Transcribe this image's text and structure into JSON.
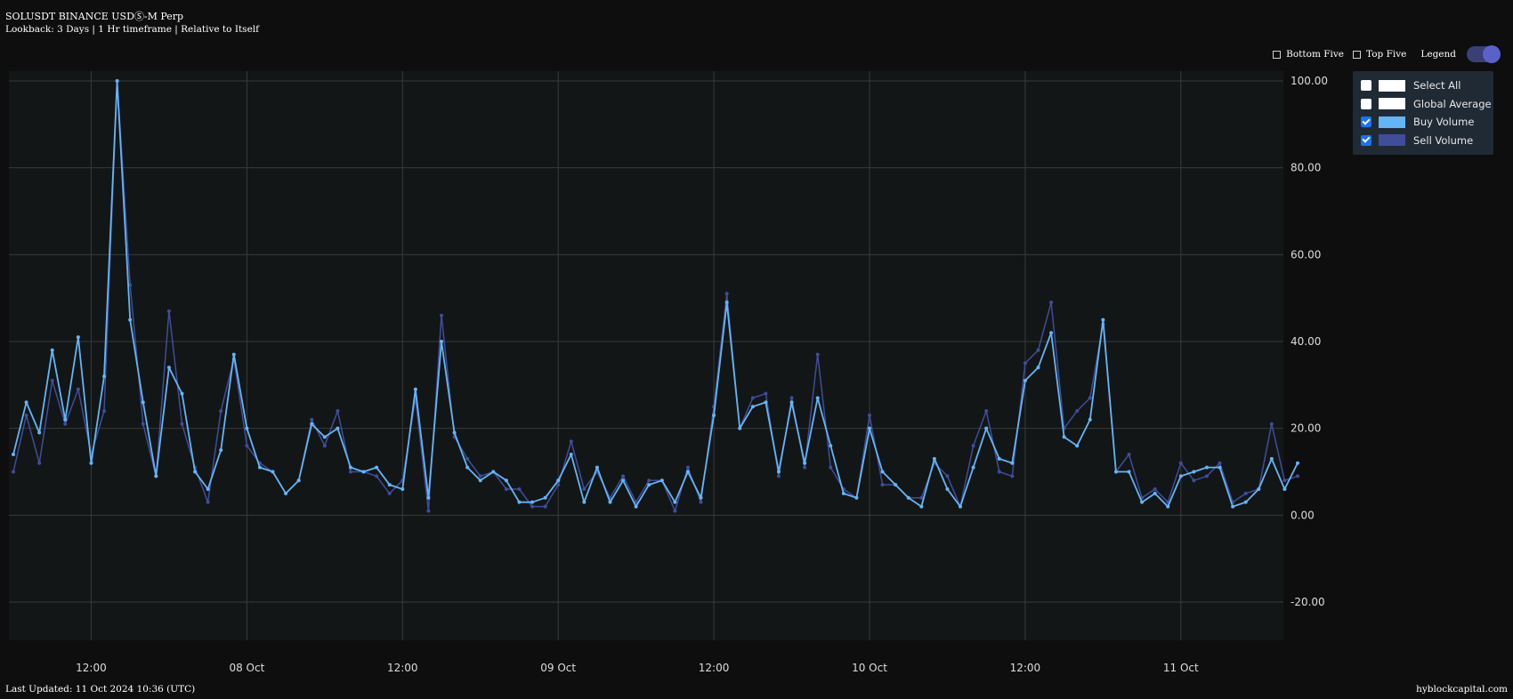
{
  "header": {
    "title": "SOLUSDT BINANCE USDⓈ-M Perp",
    "subtitle": "Lookback: 3 Days | 1 Hr timeframe | Relative to Itself"
  },
  "controls": {
    "bottom_five": "Bottom Five",
    "top_five": "Top Five",
    "legend": "Legend",
    "legend_toggle_on": true
  },
  "legend_panel": {
    "items": [
      {
        "label": "Select All",
        "checked": false,
        "color": "#ffffff"
      },
      {
        "label": "Global Average",
        "checked": false,
        "color": "#ffffff"
      },
      {
        "label": "Buy Volume",
        "checked": true,
        "color": "#64b5f6"
      },
      {
        "label": "Sell Volume",
        "checked": true,
        "color": "#3f4d9a"
      }
    ]
  },
  "footer": {
    "last_updated": "Last Updated: 11 Oct 2024 10:36 (UTC)",
    "brand": "hyblockcapital.com"
  },
  "colors": {
    "background": "#0e0e0f",
    "plot_background": "#131617",
    "grid": "#3a3a3a",
    "buy": "#64b5f6",
    "sell": "#3f4d9a"
  },
  "chart_data": {
    "type": "line",
    "title": "",
    "xlabel": "",
    "ylabel": "",
    "ylim": [
      -20,
      100
    ],
    "yticks": [
      -20,
      0,
      20,
      40,
      60,
      80,
      100
    ],
    "ytick_labels": [
      "-20.00",
      "0.00",
      "20.00",
      "40.00",
      "60.00",
      "80.00",
      "100.00"
    ],
    "x_start": "07 Oct 2024 06:00",
    "x_end": "11 Oct 2024 11:00",
    "x_interval": "1 hour",
    "xticks": [
      "12:00",
      "08 Oct",
      "12:00",
      "09 Oct",
      "12:00",
      "10 Oct",
      "12:00",
      "11 Oct"
    ],
    "grid": true,
    "legend_position": "top-right",
    "series": [
      {
        "name": "Buy Volume",
        "values": [
          14,
          26,
          19,
          38,
          22,
          41,
          12,
          32,
          100,
          45,
          26,
          9,
          34,
          28,
          10,
          6,
          15,
          37,
          20,
          11,
          10,
          5,
          8,
          21,
          18,
          20,
          11,
          10,
          11,
          7,
          6,
          29,
          4,
          40,
          19,
          11,
          8,
          10,
          8,
          3,
          3,
          4,
          8,
          14,
          3,
          11,
          3,
          8,
          2,
          7,
          8,
          3,
          10,
          4,
          23,
          49,
          20,
          25,
          26,
          10,
          26,
          12,
          27,
          16,
          5,
          4,
          20,
          10,
          7,
          4,
          2,
          13,
          6,
          2,
          11,
          20,
          13,
          12,
          31,
          34,
          42,
          18,
          16,
          22,
          45,
          10,
          10,
          3,
          5,
          2,
          9,
          10,
          11,
          11,
          2,
          3,
          6,
          13,
          6,
          12
        ]
      },
      {
        "name": "Sell Volume",
        "values": [
          10,
          23,
          12,
          31,
          21,
          29,
          14,
          24,
          100,
          53,
          21,
          9,
          47,
          21,
          11,
          3,
          24,
          36,
          16,
          12,
          10,
          5,
          8,
          22,
          16,
          24,
          10,
          10,
          9,
          5,
          8,
          27,
          1,
          46,
          18,
          13,
          9,
          10,
          6,
          6,
          2,
          2,
          7,
          17,
          6,
          10,
          4,
          9,
          3,
          8,
          8,
          1,
          11,
          3,
          25,
          51,
          20,
          27,
          28,
          9,
          27,
          11,
          37,
          11,
          6,
          4,
          23,
          7,
          7,
          4,
          4,
          12,
          9,
          2,
          16,
          24,
          10,
          9,
          35,
          38,
          49,
          20,
          24,
          27,
          44,
          10,
          14,
          4,
          6,
          3,
          12,
          8,
          9,
          12,
          3,
          5,
          6,
          21,
          8,
          9
        ]
      }
    ]
  }
}
